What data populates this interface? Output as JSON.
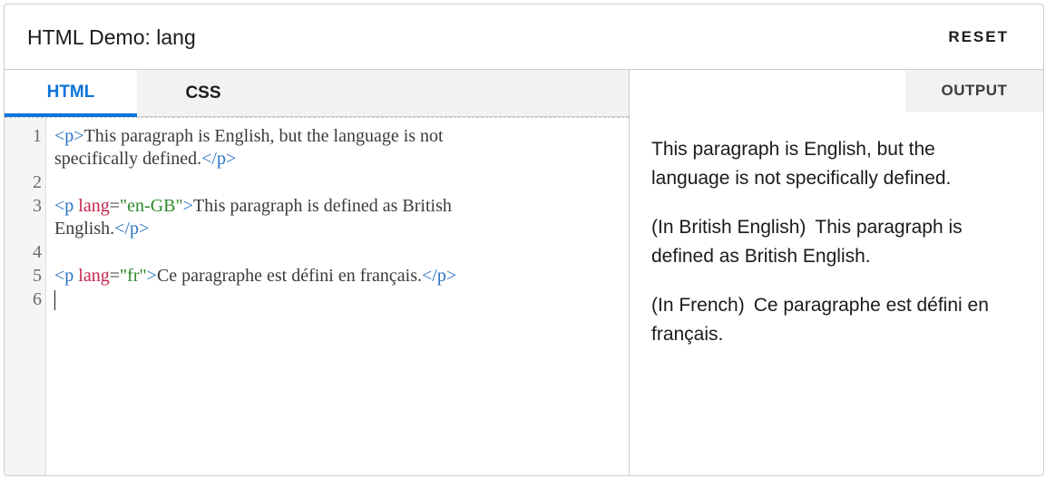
{
  "header": {
    "title": "HTML Demo: lang",
    "reset_label": "RESET"
  },
  "editor": {
    "tabs": [
      {
        "label": "HTML",
        "active": true
      },
      {
        "label": "CSS",
        "active": false
      }
    ],
    "line_numbers": [
      "1",
      "2",
      "3",
      "4",
      "5",
      "6"
    ],
    "code": {
      "line1": {
        "open_tag": "<p>",
        "text": "This paragraph is English, but the language is not",
        "text_cont": "specifically defined.",
        "close_tag": "</p>"
      },
      "line3": {
        "open_tag_start": "<p ",
        "attr_name": "lang",
        "eq": "=",
        "attr_value": "\"en-GB\"",
        "open_tag_end": ">",
        "text": "This paragraph is defined as British",
        "text_cont": "English.",
        "close_tag": "</p>"
      },
      "line5": {
        "open_tag_start": "<p ",
        "attr_name": "lang",
        "eq": "=",
        "attr_value": "\"fr\"",
        "open_tag_end": ">",
        "text": "Ce paragraphe est défini en français.",
        "close_tag": "</p>"
      }
    }
  },
  "output": {
    "label": "OUTPUT",
    "paragraphs": [
      {
        "prefix": "",
        "text": "This paragraph is English, but the language is not specifically defined."
      },
      {
        "prefix": "(In British English)",
        "text": "This paragraph is defined as British English."
      },
      {
        "prefix": "(In French)",
        "text": "Ce paragraphe est défini en français."
      }
    ]
  },
  "colors": {
    "accent": "#0b74d8",
    "tag": "#2a73c2",
    "attribute": "#c7254e",
    "attribute_value": "#2a8a2a"
  }
}
